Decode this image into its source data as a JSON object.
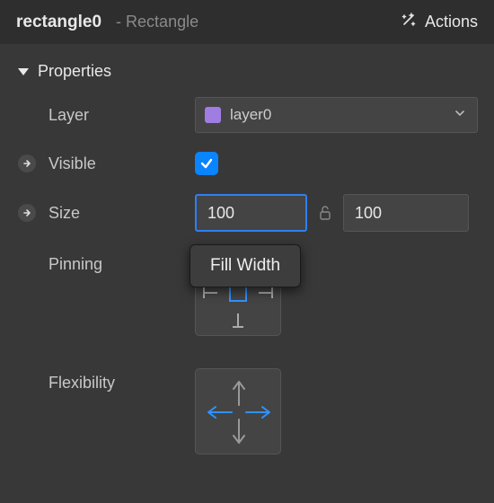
{
  "header": {
    "object_name": "rectangle0",
    "object_type": "- Rectangle",
    "actions_label": "Actions"
  },
  "section": {
    "title": "Properties"
  },
  "rows": {
    "layer": {
      "label": "Layer",
      "selected": "layer0",
      "swatch_color": "#a07de0"
    },
    "visible": {
      "label": "Visible",
      "checked": true
    },
    "size": {
      "label": "Size",
      "width": "100",
      "height": "100",
      "locked": false
    },
    "pinning": {
      "label": "Pinning",
      "tooltip": "Fill Width"
    },
    "flexibility": {
      "label": "Flexibility",
      "horizontal_active": true
    }
  }
}
